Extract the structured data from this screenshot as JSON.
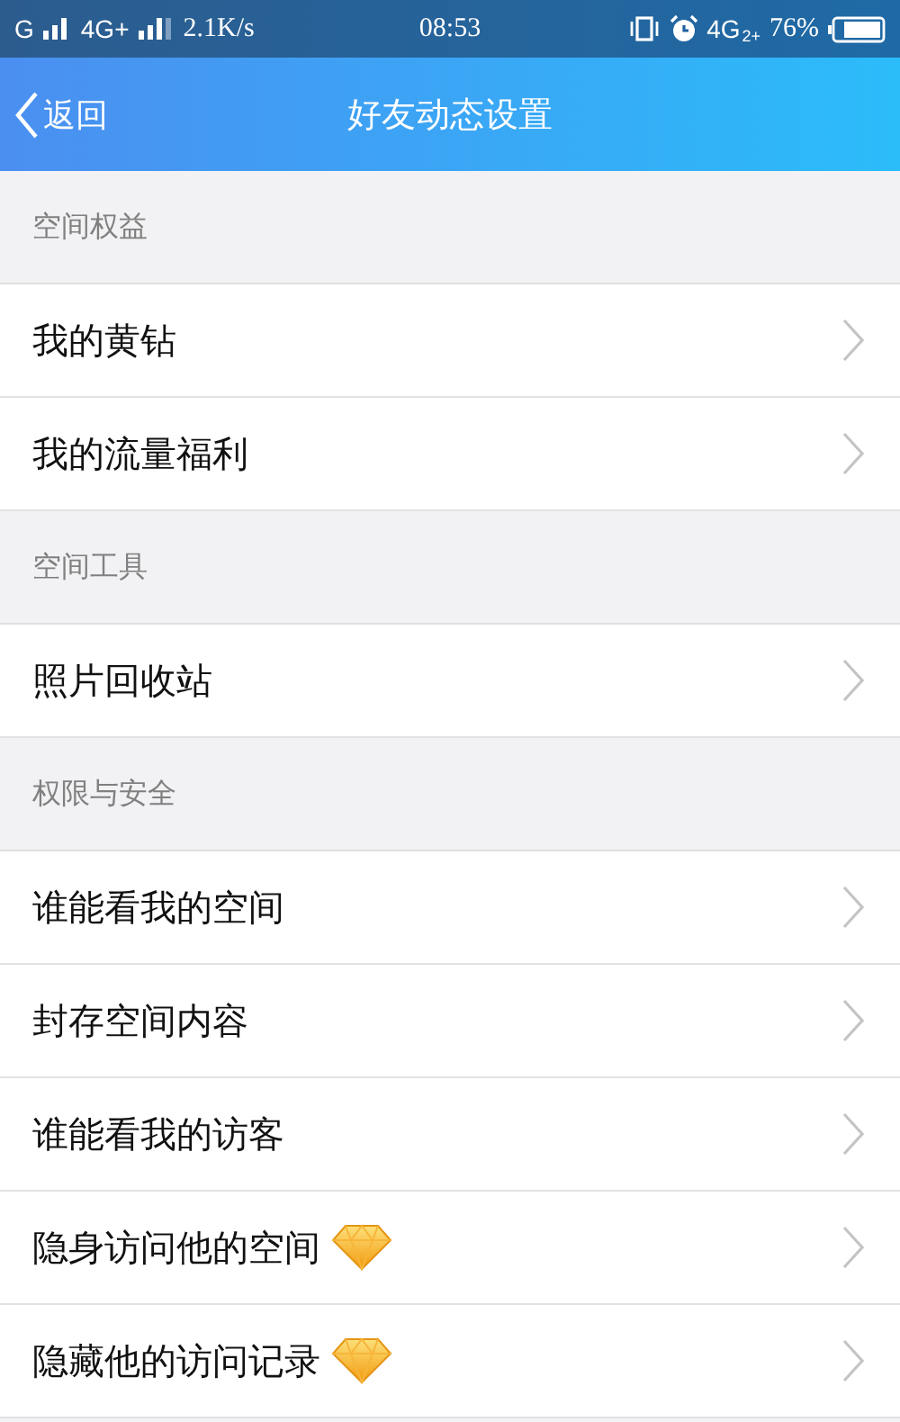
{
  "status_bar": {
    "network_1": "G",
    "network_2": "4G+",
    "speed": "2.1K/s",
    "time": "08:53",
    "network_3": "4G",
    "network_3_sim": "2+",
    "battery": "76%"
  },
  "nav": {
    "back": "返回",
    "title": "好友动态设置"
  },
  "sections": [
    {
      "title": "空间权益",
      "items": [
        {
          "label": "我的黄钻",
          "vip": false
        },
        {
          "label": "我的流量福利",
          "vip": false
        }
      ]
    },
    {
      "title": "空间工具",
      "items": [
        {
          "label": "照片回收站",
          "vip": false
        }
      ]
    },
    {
      "title": "权限与安全",
      "items": [
        {
          "label": "谁能看我的空间",
          "vip": false
        },
        {
          "label": "封存空间内容",
          "vip": false
        },
        {
          "label": "谁能看我的访客",
          "vip": false
        },
        {
          "label": "隐身访问他的空间",
          "vip": true
        },
        {
          "label": "隐藏他的访问记录",
          "vip": true
        }
      ]
    }
  ]
}
